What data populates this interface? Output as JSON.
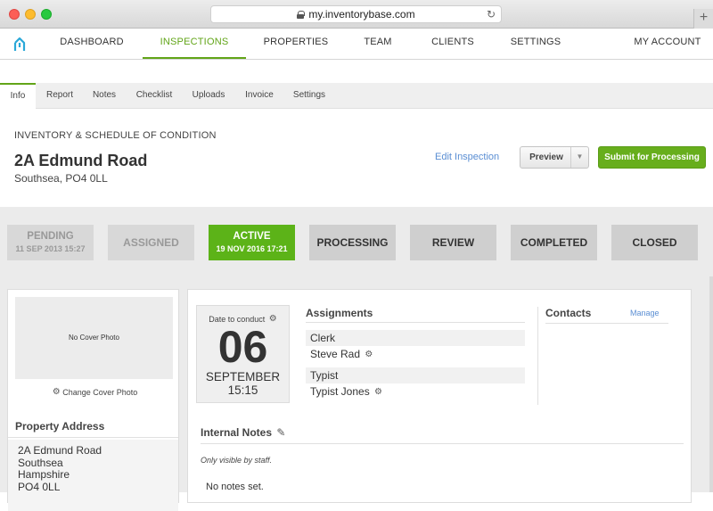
{
  "browser": {
    "url": "my.inventorybase.com",
    "new_tab": "+"
  },
  "nav": {
    "items": [
      "DASHBOARD",
      "INSPECTIONS",
      "PROPERTIES",
      "TEAM",
      "CLIENTS",
      "SETTINGS"
    ],
    "active": "INSPECTIONS",
    "account": "MY ACCOUNT"
  },
  "subnav": {
    "items": [
      "Info",
      "Report",
      "Notes",
      "Checklist",
      "Uploads",
      "Invoice",
      "Settings"
    ],
    "active": "Info"
  },
  "header": {
    "kicker": "INVENTORY & SCHEDULE OF CONDITION",
    "title": "2A Edmund Road",
    "subtitle": "Southsea, PO4 0LL",
    "edit_link": "Edit Inspection",
    "preview_label": "Preview",
    "submit_label": "Submit for Processing"
  },
  "statuses": [
    {
      "label": "PENDING",
      "sub": "11 SEP 2013 15:27"
    },
    {
      "label": "ASSIGNED",
      "sub": ""
    },
    {
      "label": "ACTIVE",
      "sub": "19 NOV 2016 17:21"
    },
    {
      "label": "PROCESSING",
      "sub": ""
    },
    {
      "label": "REVIEW",
      "sub": ""
    },
    {
      "label": "COMPLETED",
      "sub": ""
    },
    {
      "label": "CLOSED",
      "sub": ""
    }
  ],
  "cover": {
    "placeholder": "No Cover Photo",
    "change_label": "Change Cover Photo"
  },
  "property_address": {
    "heading": "Property Address",
    "lines": [
      "2A Edmund Road",
      "Southsea",
      "Hampshire",
      "PO4 0LL"
    ]
  },
  "date_box": {
    "label": "Date to conduct",
    "day": "06",
    "month": "SEPTEMBER",
    "time": "15:15"
  },
  "assignments": {
    "heading": "Assignments",
    "rows": [
      {
        "role": "Clerk",
        "name": "Steve Rad"
      },
      {
        "role": "Typist",
        "name": "Typist Jones"
      }
    ]
  },
  "contacts": {
    "heading": "Contacts",
    "manage": "Manage"
  },
  "internal_notes": {
    "heading": "Internal Notes",
    "subtext": "Only visible by staff.",
    "empty": "No notes set."
  },
  "colors": {
    "brand_green": "#62a518",
    "active_status": "#5cb318",
    "link_blue": "#5a8ed3"
  }
}
